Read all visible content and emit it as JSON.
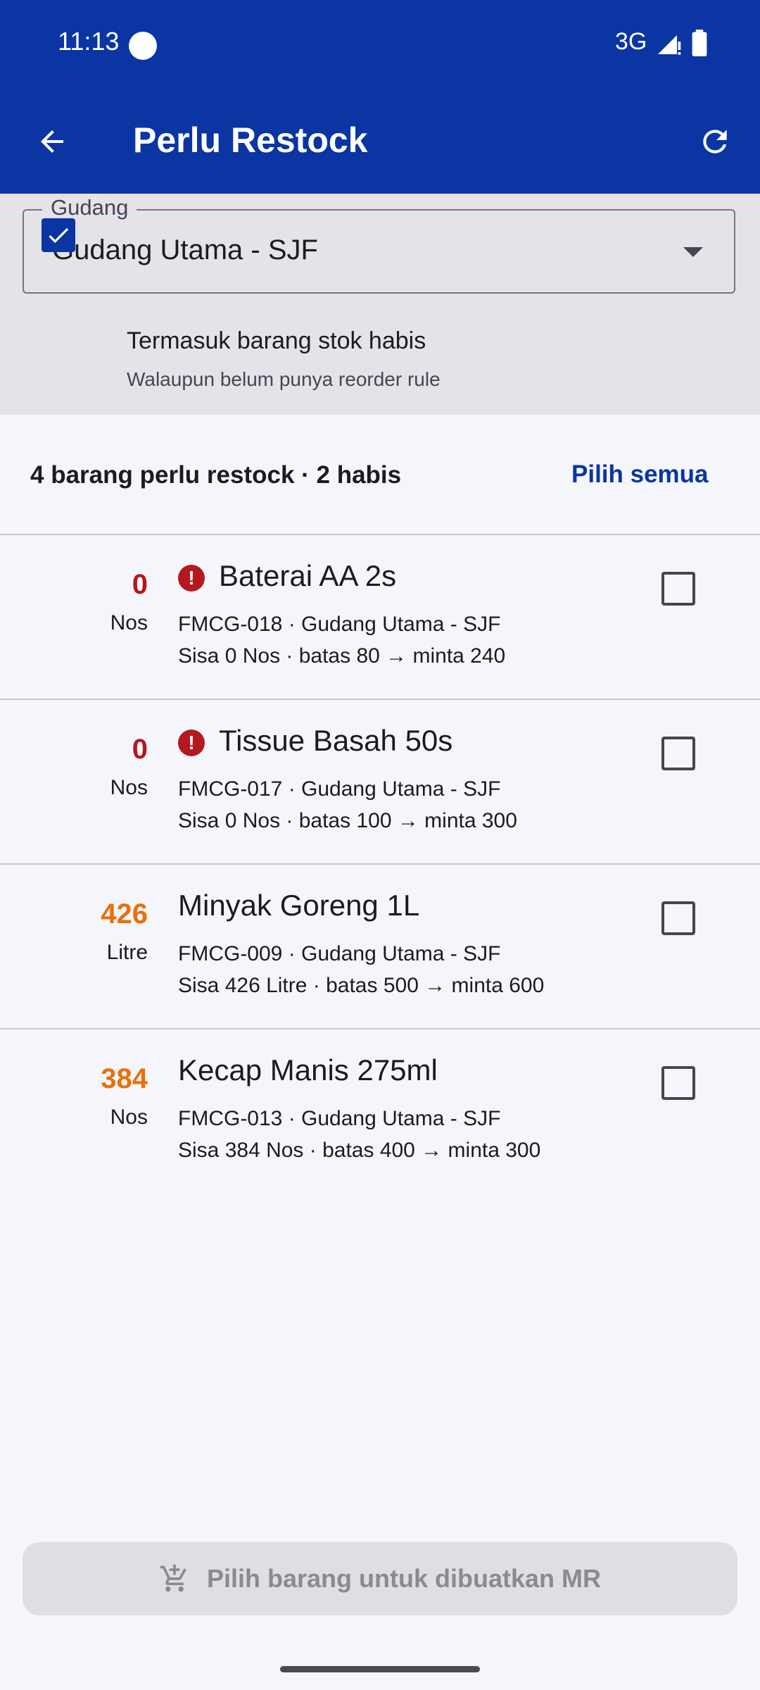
{
  "status_bar": {
    "time": "11:13",
    "network": "3G"
  },
  "header": {
    "title": "Perlu Restock",
    "back_icon": "arrow-left-icon",
    "refresh_icon": "refresh-icon"
  },
  "filter": {
    "warehouse_label": "Gudang",
    "warehouse_value": "Gudang Utama - SJF",
    "include_out_of_stock": {
      "checked": true,
      "title": "Termasuk barang stok habis",
      "subtitle": "Walaupun belum punya reorder rule"
    }
  },
  "summary": {
    "text": "4 barang perlu restock · 2 habis",
    "select_all": "Pilih semua"
  },
  "items": [
    {
      "qty": "0",
      "unit": "Nos",
      "qty_color": "#b3191e",
      "alert": true,
      "name": "Baterai AA 2s",
      "code_line": "FMCG-018 · Gudang Utama - SJF",
      "detail": "Sisa 0 Nos · batas 80 → minta 240",
      "checked": false
    },
    {
      "qty": "0",
      "unit": "Nos",
      "qty_color": "#b3191e",
      "alert": true,
      "name": "Tissue Basah 50s",
      "code_line": "FMCG-017 · Gudang Utama - SJF",
      "detail": "Sisa 0 Nos · batas 100 → minta 300",
      "checked": false
    },
    {
      "qty": "426",
      "unit": "Litre",
      "qty_color": "#e8710a",
      "alert": false,
      "name": "Minyak Goreng 1L",
      "code_line": "FMCG-009 · Gudang Utama - SJF",
      "detail": "Sisa 426 Litre · batas 500 → minta 600",
      "checked": false
    },
    {
      "qty": "384",
      "unit": "Nos",
      "qty_color": "#e8710a",
      "alert": false,
      "name": "Kecap Manis 275ml",
      "code_line": "FMCG-013 · Gudang Utama - SJF",
      "detail": "Sisa 384 Nos · batas 400 → minta 300",
      "checked": false
    }
  ],
  "action_button": {
    "label": "Pilih barang untuk dibuatkan MR",
    "icon": "add-to-cart-icon",
    "enabled": false
  },
  "colors": {
    "primary": "#0a35a3",
    "out_of_stock": "#b3191e",
    "low_stock": "#e8710a"
  }
}
